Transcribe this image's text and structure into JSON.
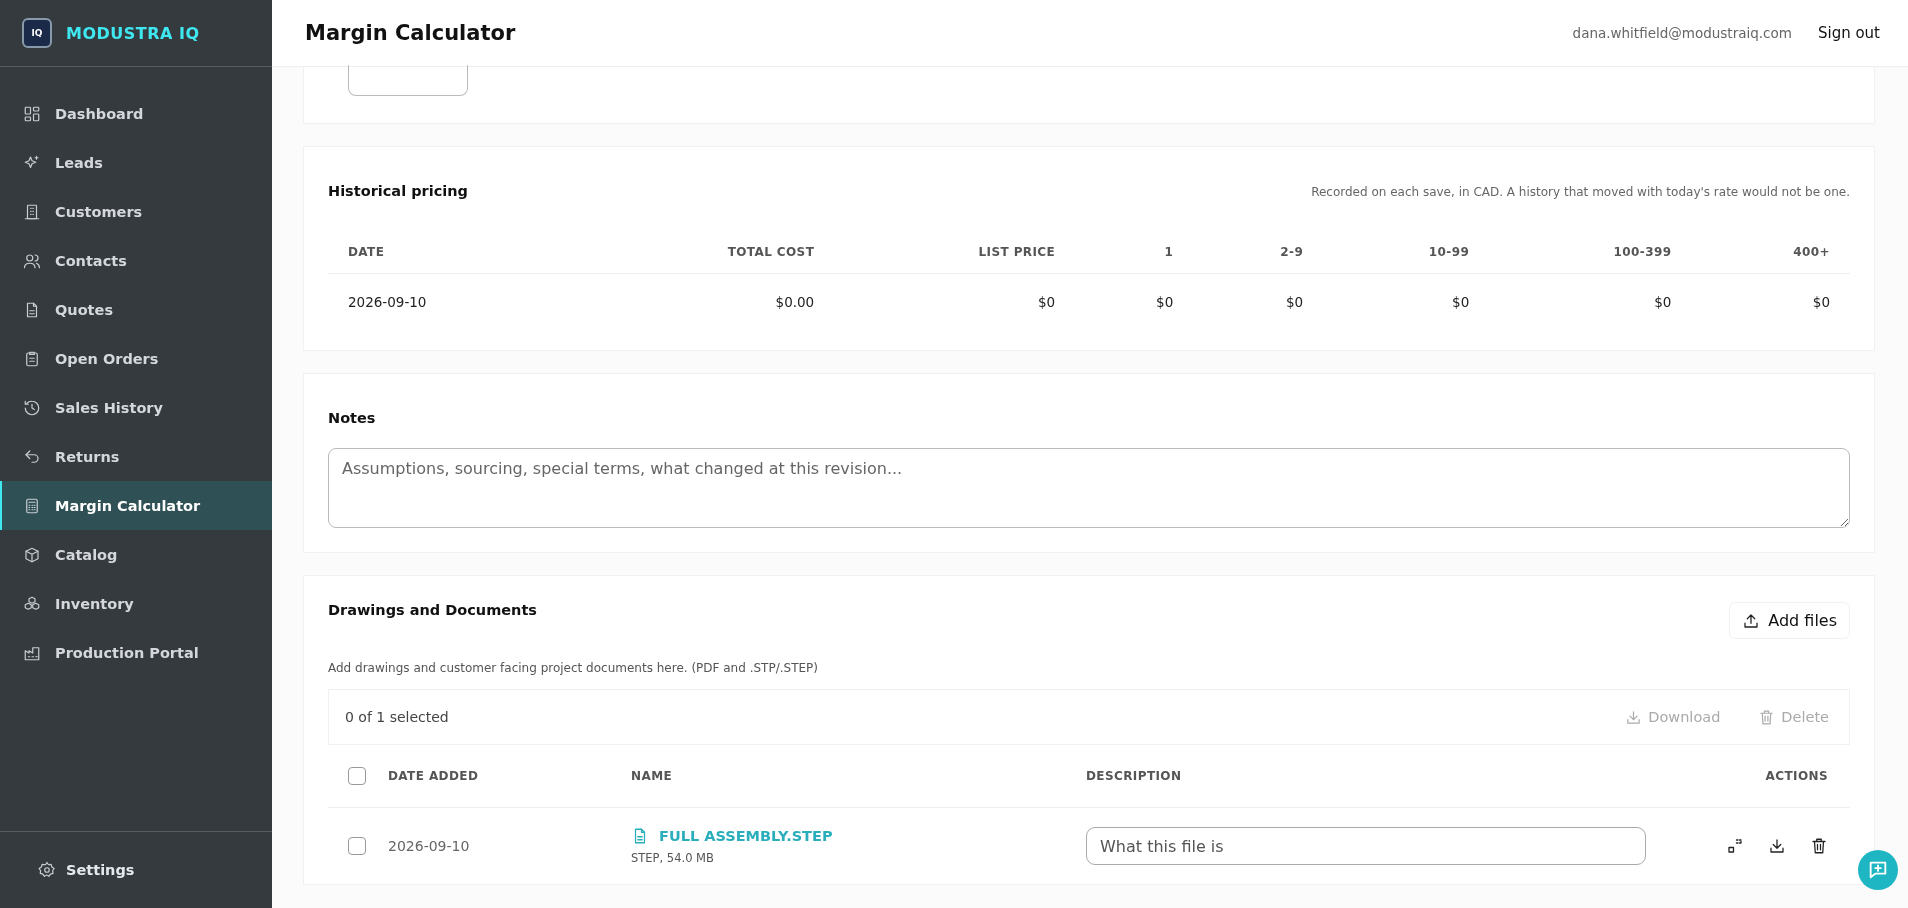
{
  "brand": {
    "name": "MODUSTRA IQ",
    "badge": "IQ"
  },
  "sidebar": {
    "items": [
      {
        "label": "Dashboard",
        "selected": false
      },
      {
        "label": "Leads",
        "selected": false
      },
      {
        "label": "Customers",
        "selected": false
      },
      {
        "label": "Contacts",
        "selected": false
      },
      {
        "label": "Quotes",
        "selected": false
      },
      {
        "label": "Open Orders",
        "selected": false
      },
      {
        "label": "Sales History",
        "selected": false
      },
      {
        "label": "Returns",
        "selected": false
      },
      {
        "label": "Margin Calculator",
        "selected": true
      },
      {
        "label": "Catalog",
        "selected": false
      },
      {
        "label": "Inventory",
        "selected": false
      },
      {
        "label": "Production Portal",
        "selected": false
      }
    ],
    "settings": "Settings"
  },
  "header": {
    "title": "Margin Calculator",
    "user": "dana.whitfield@modustraiq.com",
    "sign_out": "Sign out"
  },
  "historical_pricing": {
    "title": "Historical pricing",
    "note": "Recorded on each save, in CAD. A history that moved with today's rate would not be one.",
    "columns": [
      "DATE",
      "TOTAL COST",
      "LIST PRICE",
      "1",
      "2-9",
      "10-99",
      "100-399",
      "400+"
    ],
    "rows": [
      [
        "2026-09-10",
        "$0.00",
        "$0",
        "$0",
        "$0",
        "$0",
        "$0",
        "$0"
      ]
    ]
  },
  "notes": {
    "title": "Notes",
    "placeholder": "Assumptions, sourcing, special terms, what changed at this revision..."
  },
  "documents": {
    "title": "Drawings and Documents",
    "add_button": "Add files",
    "hint": "Add drawings and customer facing project documents here. (PDF and .STP/.STEP)",
    "selection": "0 of 1 selected",
    "download": "Download",
    "delete": "Delete",
    "all_checked": false,
    "columns": [
      "DATE ADDED",
      "NAME",
      "DESCRIPTION",
      "ACTIONS"
    ],
    "files": [
      {
        "checked": false,
        "date": "2026-09-10",
        "name": "FULL ASSEMBLY.STEP",
        "meta": "STEP, 54.0 MB",
        "description_placeholder": "What this file is"
      }
    ]
  }
}
